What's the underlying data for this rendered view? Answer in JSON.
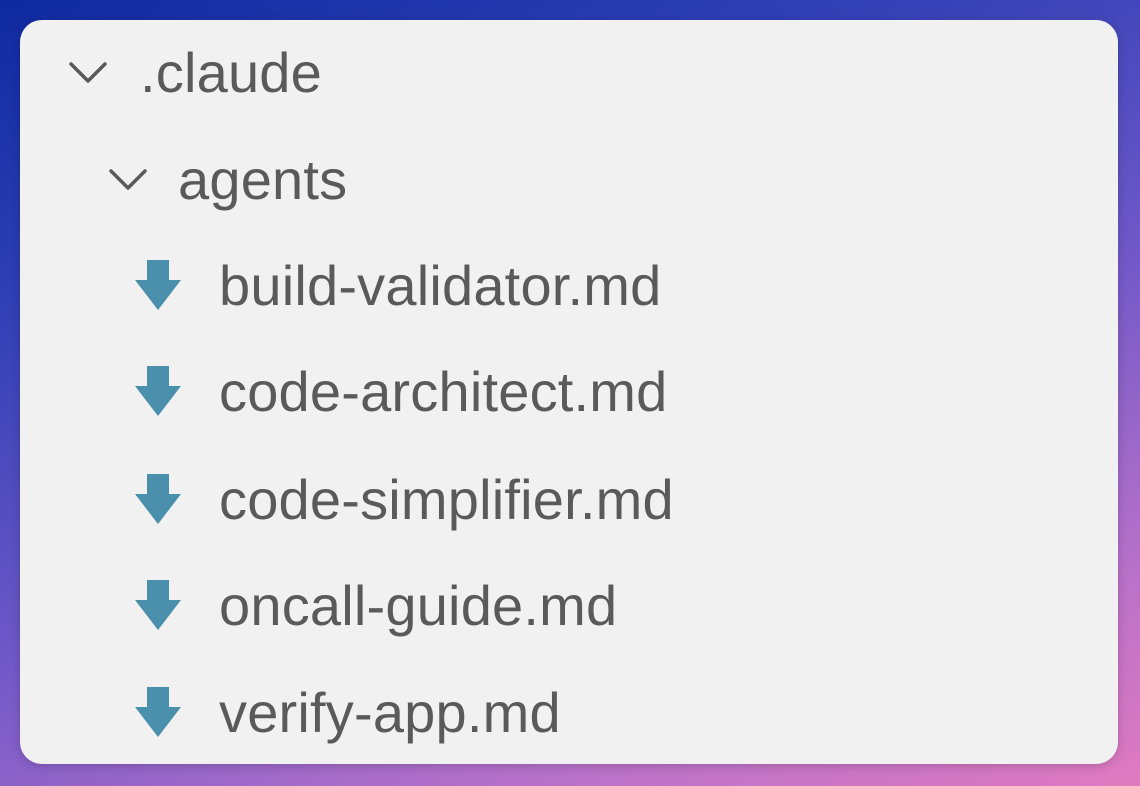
{
  "tree": {
    "root_folder": {
      "label": ".claude",
      "expanded": true,
      "icon": "chevron-down-icon"
    },
    "sub_folder": {
      "label": "agents",
      "expanded": true,
      "icon": "chevron-down-icon"
    },
    "files": [
      {
        "label": "build-validator.md",
        "icon": "markdown-download-arrow-icon"
      },
      {
        "label": "code-architect.md",
        "icon": "markdown-download-arrow-icon"
      },
      {
        "label": "code-simplifier.md",
        "icon": "markdown-download-arrow-icon"
      },
      {
        "label": "oncall-guide.md",
        "icon": "markdown-download-arrow-icon"
      },
      {
        "label": "verify-app.md",
        "icon": "markdown-download-arrow-icon"
      }
    ]
  },
  "colors": {
    "panel_background": "#f1f1f1",
    "text": "#5a5a5a",
    "chevron": "#5a5a5a",
    "file_icon": "#4a90ad"
  }
}
